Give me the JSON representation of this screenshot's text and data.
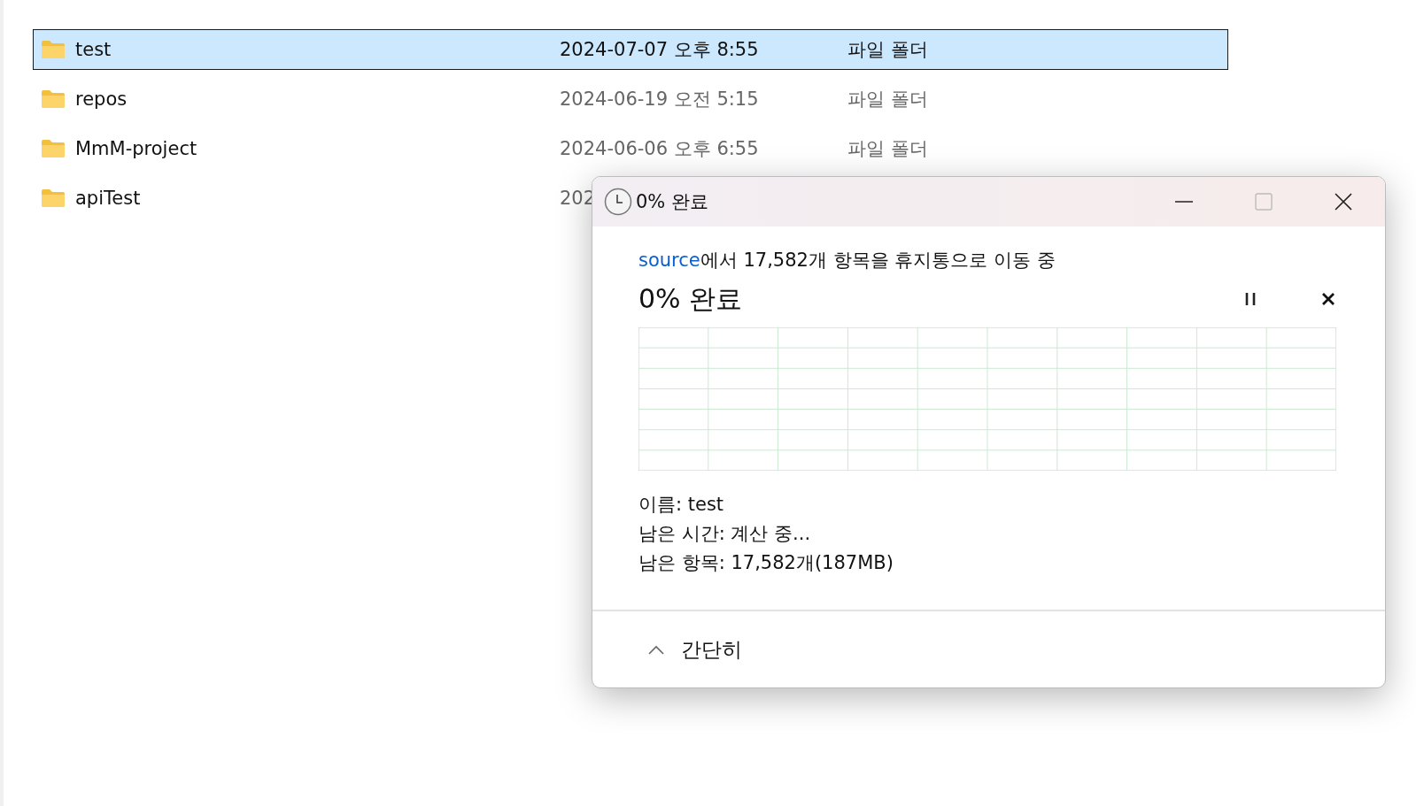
{
  "files": [
    {
      "name": "test",
      "date": "2024-07-07 오후 8:55",
      "type": "파일 폴더",
      "selected": true
    },
    {
      "name": "repos",
      "date": "2024-06-19 오전 5:15",
      "type": "파일 폴더",
      "selected": false
    },
    {
      "name": "MmM-project",
      "date": "2024-06-06 오후 6:55",
      "type": "파일 폴더",
      "selected": false
    },
    {
      "name": "apiTest",
      "date": "202",
      "selected": false
    }
  ],
  "dialog": {
    "title": "0% 완료",
    "source_link": "source",
    "message": "에서 17,582개 항목을 휴지통으로 이동 중",
    "progress_heading": "0% 완료",
    "details": [
      "이름: test",
      "남은 시간: 계산 중...",
      "남은 항목: 17,582개(187MB)"
    ],
    "collapse_label": "간단히"
  }
}
